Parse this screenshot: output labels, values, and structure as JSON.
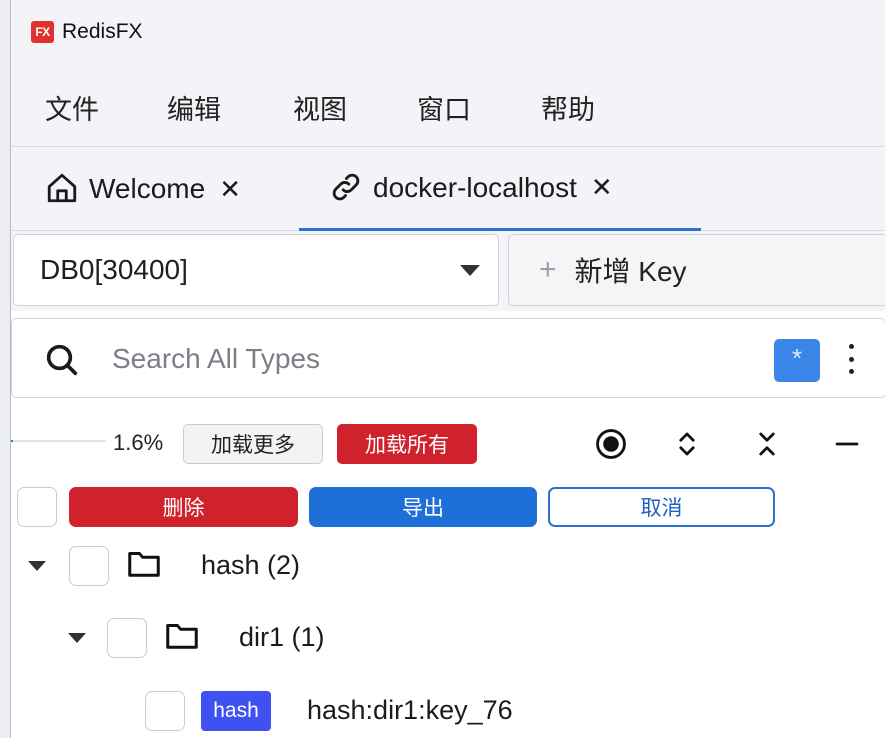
{
  "app": {
    "title": "RedisFX",
    "logo_text": "FX",
    "logo_color": "#e0332f"
  },
  "menu": {
    "items": [
      "文件",
      "编辑",
      "视图",
      "窗口",
      "帮助"
    ]
  },
  "tabs": [
    {
      "label": "Welcome",
      "icon": "home-icon",
      "close": "✕"
    },
    {
      "label": "docker-localhost",
      "icon": "link-icon",
      "close": "✕",
      "active": true
    }
  ],
  "db_select": {
    "value": "DB0[30400]"
  },
  "add_key": {
    "plus": "+",
    "label": "新增 Key"
  },
  "search": {
    "placeholder": "Search All Types",
    "value": "",
    "regex_glyph": "*"
  },
  "load": {
    "progress_text": "1.6%",
    "progress_fraction": 0.016,
    "load_more": "加载更多",
    "load_all": "加载所有"
  },
  "actions": {
    "delete": "删除",
    "export": "导出",
    "cancel": "取消"
  },
  "tree": [
    {
      "label": "hash (2)",
      "kind": "folder",
      "level": 0
    },
    {
      "label": "dir1 (1)",
      "kind": "folder",
      "level": 1
    },
    {
      "label": "hash:dir1:key_76",
      "kind": "key",
      "type_badge": "hash",
      "level": 2
    }
  ],
  "colors": {
    "accent": "#2b6fd1",
    "danger": "#d0222c",
    "export": "#1f6fd8",
    "hash_badge": "#3f51f0",
    "regex_toggle": "#3a86e8"
  }
}
